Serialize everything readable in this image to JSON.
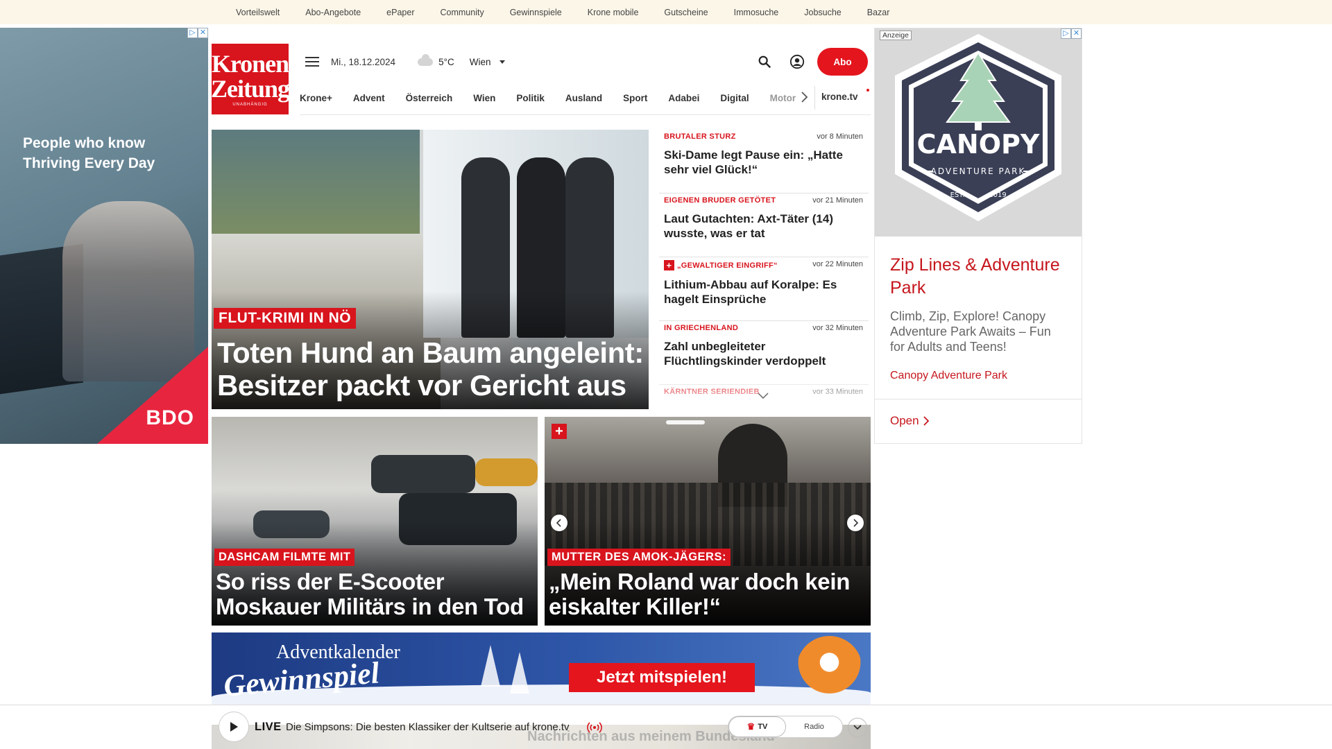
{
  "topbar": {
    "links": [
      "Vorteilswelt",
      "Abo-Angebote",
      "ePaper",
      "Community",
      "Gewinnspiele",
      "Krone mobile",
      "Gutscheine",
      "Immosuche",
      "Jobsuche",
      "Bazar"
    ]
  },
  "ad_left": {
    "headline_line1": "People who know",
    "headline_line2": "Thriving Every Day",
    "brand": "BDO"
  },
  "logo": {
    "line1": "Kronen",
    "line2": "Zeitung",
    "tagline": "UNABHÄNGIG"
  },
  "header": {
    "date": "Mi., 18.12.2024",
    "weather_icon": "cloud-icon",
    "temperature": "5°C",
    "location": "Wien",
    "abo_label": "Abo"
  },
  "nav": {
    "items": [
      "Krone+",
      "Advent",
      "Österreich",
      "Wien",
      "Politik",
      "Ausland",
      "Sport",
      "Adabei",
      "Digital"
    ],
    "overflow_item": "Motor",
    "tv_label": "krone.tv"
  },
  "hero": {
    "kicker": "FLUT-KRIMI IN NÖ",
    "headline": "Toten Hund an Baum angeleint: Besitzer packt vor Gericht aus"
  },
  "news": [
    {
      "tag": "BRUTALER STURZ",
      "time": "vor 8 Minuten",
      "title": "Ski-Dame legt Pause ein: „Hatte sehr viel Glück!“",
      "plus": false
    },
    {
      "tag": "EIGENEN BRUDER GETÖTET",
      "time": "vor 21 Minuten",
      "title": "Laut Gutachten: Axt-Täter (14) wusste, was er tat",
      "plus": false
    },
    {
      "tag": "„GEWALTIGER EINGRIFF“",
      "time": "vor 22 Minuten",
      "title": "Lithium-Abbau auf Koralpe: Es hagelt Einsprüche",
      "plus": true
    },
    {
      "tag": "IN GRIECHENLAND",
      "time": "vor 32 Minuten",
      "title": "Zahl unbegleiteter Flüchtlingskinder verdoppelt",
      "plus": false
    },
    {
      "tag": "KÄRNTNER SERIENDIEB",
      "time": "vor 33 Minuten",
      "title": "",
      "plus": false
    }
  ],
  "teasers": [
    {
      "kicker": "DASHCAM FILMTE MIT",
      "headline": "So riss der E-Scooter Moskauer Militärs in den Tod"
    },
    {
      "kicker": "MUTTER DES AMOK-JÄGERS:",
      "headline": "„Mein Roland war doch kein eiskalter Killer!“"
    }
  ],
  "banner": {
    "title_line1": "Adventkalender",
    "title_line2": "Gewinnspiel",
    "cta": "Jetzt mitspielen!"
  },
  "ad_right": {
    "label": "Anzeige",
    "logo_text": "CANOPY",
    "logo_sub": "ADVENTURE PARK",
    "logo_est": "EST.",
    "logo_year": "2019",
    "headline": "Zip Lines & Adventure Park",
    "description": "Climb, Zip, Explore! Canopy Adventure Park Awaits – Fun for Adults and Teens!",
    "sponsor": "Canopy Adventure Park",
    "open_label": "Open"
  },
  "player": {
    "live_label": "LIVE",
    "program": "Die Simpsons: Die besten Klassiker der Kultserie auf krone.tv",
    "tv_label": "TV",
    "radio_label": "Radio",
    "peek_text": "Nachrichten aus meinem Bundesland"
  },
  "colors": {
    "brand_red": "#d8141d",
    "topbar_bg": "#fbf6e8"
  }
}
